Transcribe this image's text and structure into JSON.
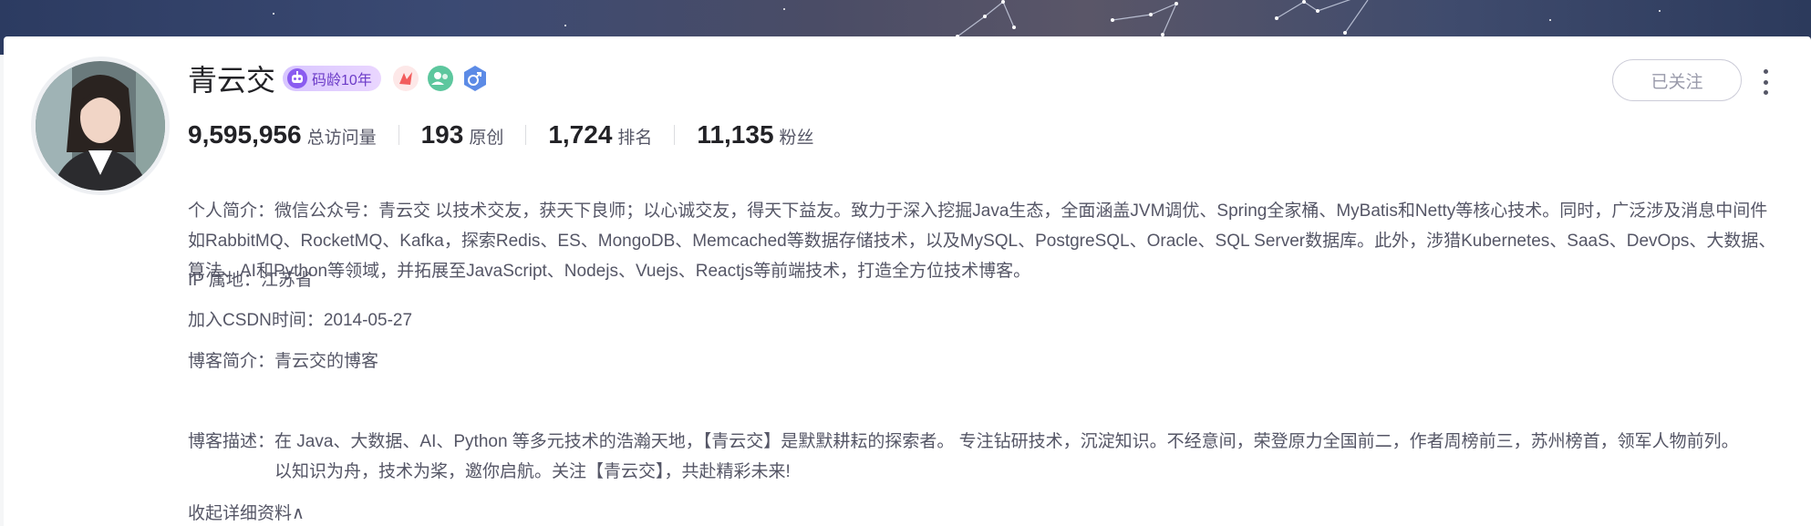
{
  "banner": {
    "icon": "constellation-banner"
  },
  "profile": {
    "name": "青云交",
    "code_age_badge": "码龄10年",
    "badge_icons": [
      "robot-icon",
      "honor-icon",
      "community-icon",
      "gender-male-icon"
    ]
  },
  "stats": [
    {
      "value": "9,595,956",
      "label": "总访问量"
    },
    {
      "value": "193",
      "label": "原创"
    },
    {
      "value": "1,724",
      "label": "排名"
    },
    {
      "value": "11,135",
      "label": "粉丝"
    }
  ],
  "intro": "个人简介：微信公众号：青云交 以技术交友，获天下良师；以心诚交友，得天下益友。致力于深入挖掘Java生态，全面涵盖JVM调优、Spring全家桶、MyBatis和Netty等核心技术。同时，广泛涉及消息中间件如RabbitMQ、RocketMQ、Kafka，探索Redis、ES、MongoDB、Memcached等数据存储技术，以及MySQL、PostgreSQL、Oracle、SQL Server数据库。此外，涉猎Kubernetes、SaaS、DevOps、大数据、算法、AI和Python等领域，并拓展至JavaScript、Nodejs、Vuejs、Reactjs等前端技术，打造全方位技术博客。",
  "ip_location": "IP 属地：江苏省",
  "join_date": "加入CSDN时间：2014-05-27",
  "blog_intro": "博客简介：青云交的博客",
  "blog_desc": {
    "label": "博客描述：",
    "text": "在 Java、大数据、AI、Python 等多元技术的浩瀚天地，【青云交】是默默耕耘的探索者。 专注钻研技术，沉淀知识。不经意间，荣登原力全国前二，作者周榜前三，苏州榜首，领军人物前列。 以知识为舟，技术为桨，邀你启航。关注【青云交】，共赴精彩未来!"
  },
  "collapse_label": "收起详细资料∧",
  "follow_button": "已关注",
  "more_icon": "more-vertical-icon",
  "colors": {
    "text_primary": "#222226",
    "text_secondary": "#555666",
    "badge_purple": "#6c3cc8",
    "honor_red": "#f25d5d",
    "community_green": "#5dc79e",
    "gender_blue": "#5c8be6"
  }
}
